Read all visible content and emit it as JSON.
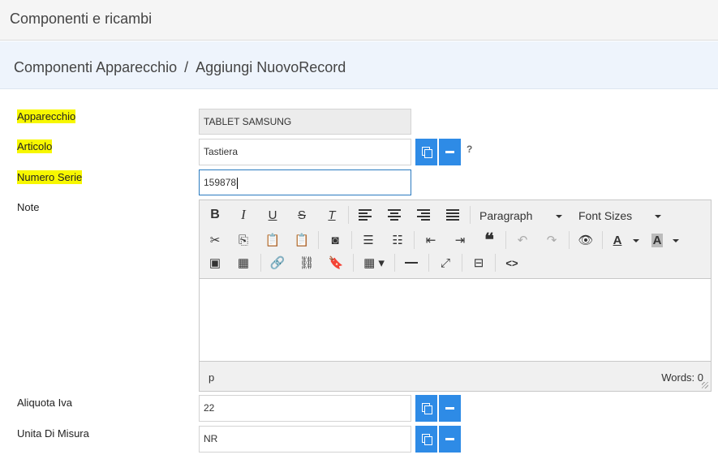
{
  "header": {
    "title": "Componenti e ricambi"
  },
  "breadcrumb": {
    "items": [
      "Componenti Apparecchio",
      "Aggiungi NuovoRecord"
    ],
    "separator": "/"
  },
  "form": {
    "apparecchio": {
      "label": "Apparecchio",
      "value": "TABLET SAMSUNG"
    },
    "articolo": {
      "label": "Articolo",
      "value": "Tastiera",
      "help": "?"
    },
    "numero_serie": {
      "label": "Numero Serie",
      "value": "159878"
    },
    "note": {
      "label": "Note"
    },
    "aliquota_iva": {
      "label": "Aliquota Iva",
      "value": "22"
    },
    "unita_misura": {
      "label": "Unita Di Misura",
      "value": "NR"
    }
  },
  "editor": {
    "toolbar": {
      "bold": "B",
      "italic": "I",
      "underline": "U",
      "strikethrough": "S",
      "clear_format": "T",
      "format_dropdown": "Paragraph",
      "font_size_dropdown": "Font Sizes",
      "blockquote": "❝",
      "text_color": "A",
      "bg_color": "A",
      "code": "<>"
    },
    "status_path": "p",
    "word_count": "Words: 0"
  },
  "colors": {
    "accent": "#2e8be6",
    "highlight": "#f7f700",
    "crumb_bg": "#eef4fc"
  },
  "icons": [
    "copy-icon",
    "minus-icon",
    "help-icon"
  ]
}
